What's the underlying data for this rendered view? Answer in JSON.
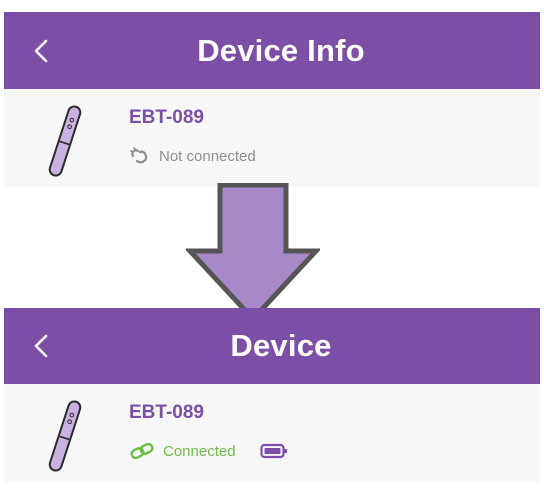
{
  "colors": {
    "header_bg": "#7b4fa8",
    "accent": "#7b4fa8",
    "arrow_fill": "#a889c7",
    "arrow_stroke": "#555555",
    "disconnected_text": "#8e8e8e",
    "connected_text": "#6dbd45"
  },
  "top_screen": {
    "header": {
      "back_icon": "chevron-left-icon",
      "title": "Device Info"
    },
    "device": {
      "icon": "stylus-device-icon",
      "name": "EBT-089",
      "status_icon": "broken-link-icon",
      "status_text": "Not connected"
    }
  },
  "transition": {
    "icon": "down-arrow-icon"
  },
  "bottom_screen": {
    "header": {
      "back_icon": "chevron-left-icon",
      "title": "Device"
    },
    "device": {
      "icon": "stylus-device-icon",
      "name": "EBT-089",
      "status_icon": "link-icon",
      "status_text": "Connected",
      "battery_icon": "battery-icon"
    }
  }
}
